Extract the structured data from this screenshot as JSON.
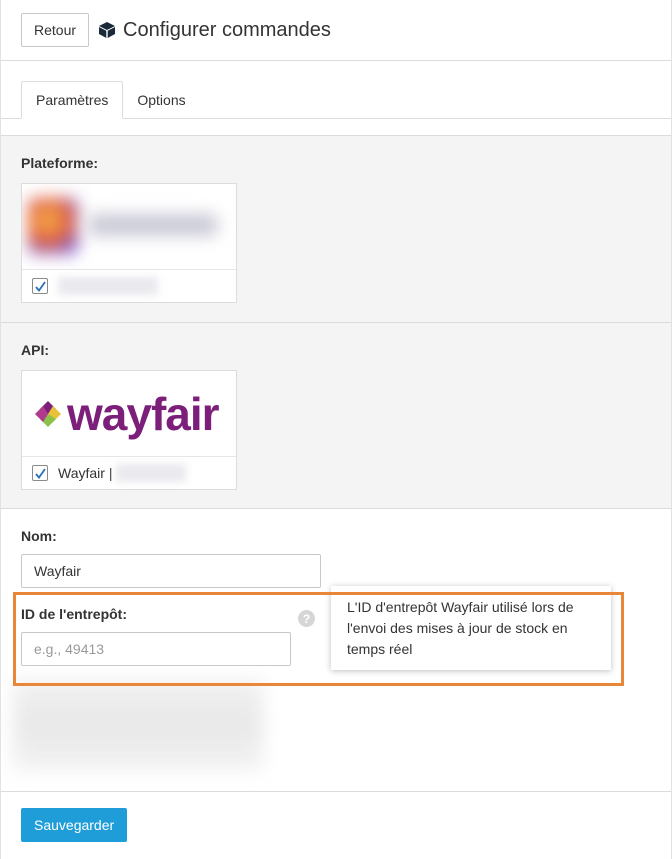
{
  "header": {
    "back_label": "Retour",
    "title": "Configurer commandes",
    "icon": "cube-icon"
  },
  "tabs": [
    {
      "label": "Paramètres",
      "active": true
    },
    {
      "label": "Options",
      "active": false
    }
  ],
  "platform": {
    "label": "Plateforme:",
    "checked": true
  },
  "api": {
    "label": "API:",
    "logo_text": "wayfair",
    "checkbox_label": "Wayfair |",
    "checked": true,
    "brand_color": "#7b1f7a"
  },
  "form": {
    "name_label": "Nom:",
    "name_value": "Wayfair",
    "warehouse_label": "ID de l'entrepôt:",
    "warehouse_placeholder": "e.g., 49413",
    "help_symbol": "?",
    "tooltip_text": "L'ID d'entrepôt Wayfair utilisé lors de l'envoi des mises à jour de stock en temps réel"
  },
  "footer": {
    "save_label": "Sauvegarder"
  },
  "colors": {
    "accent": "#1f9dd8",
    "highlight": "#e8873a",
    "check": "#2a6fb5"
  }
}
